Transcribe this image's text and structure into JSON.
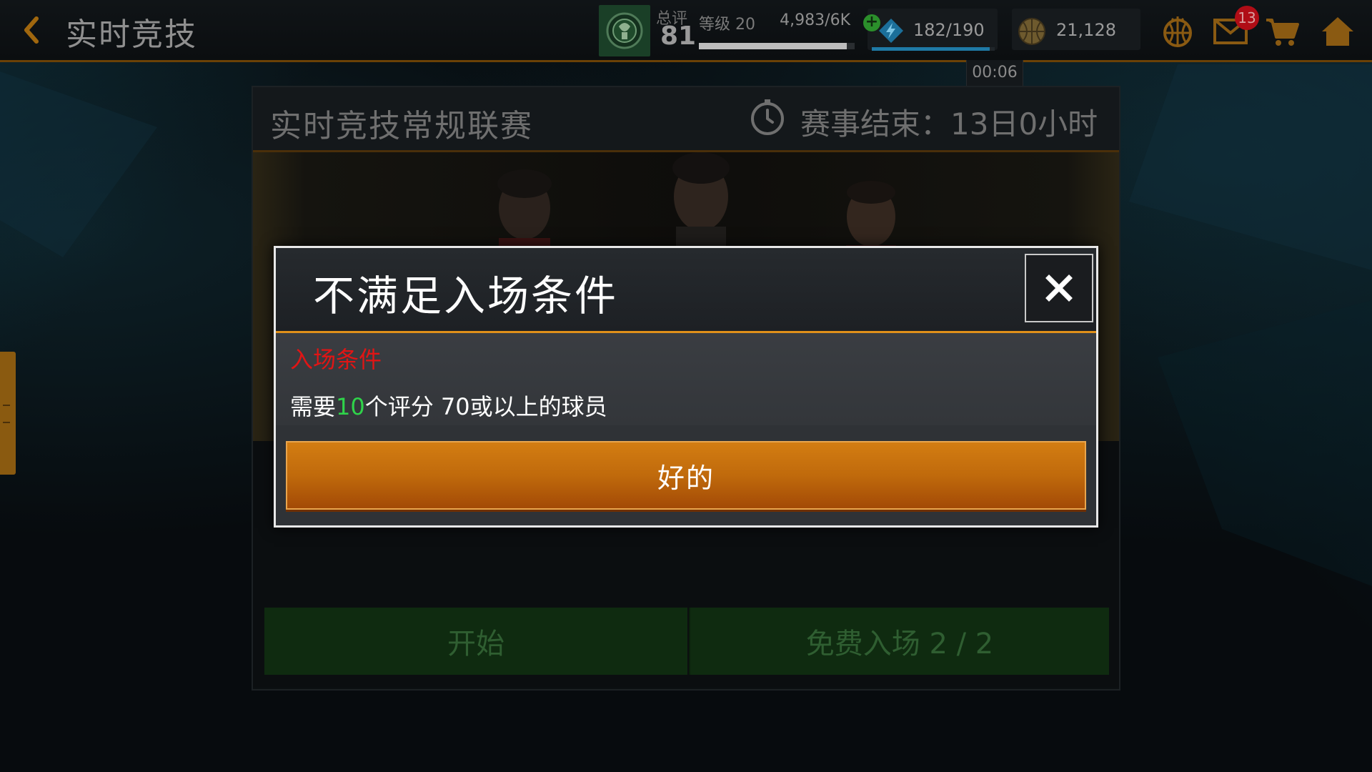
{
  "topbar": {
    "title": "实时竞技",
    "rating_label": "总评",
    "rating_value": "81",
    "level_label": "等级 20",
    "xp_text": "4,983/6K",
    "xp_fraction": 0.95,
    "energy_text": "182/190",
    "energy_fraction": 0.96,
    "energy_timer": "00:06",
    "coins_text": "21,128",
    "mail_badge": "13",
    "icons": {
      "back": "back-arrow-icon",
      "team_logo": "celtics-logo-icon",
      "energy": "energy-bolt-icon",
      "coin": "basketball-coin-icon",
      "ball": "basketball-icon",
      "mail": "mail-icon",
      "cart": "shopping-cart-icon",
      "home": "home-icon"
    }
  },
  "league": {
    "title": "实时竞技常规联赛",
    "end_text": "赛事结束：13日0小时",
    "start_label": "开始",
    "free_entry_label": "免费入场 2 / 2"
  },
  "modal": {
    "title": "不满足入场条件",
    "requirement_heading": "入场条件",
    "requirement_prefix": "需要",
    "requirement_count": "10",
    "requirement_suffix": "个评分 70或以上的球员",
    "ok_label": "好的"
  },
  "colors": {
    "accent_orange": "#e0901a",
    "ok_button": "#c06a0c",
    "requirement_red": "#e01515",
    "requirement_green": "#2fd34a"
  }
}
